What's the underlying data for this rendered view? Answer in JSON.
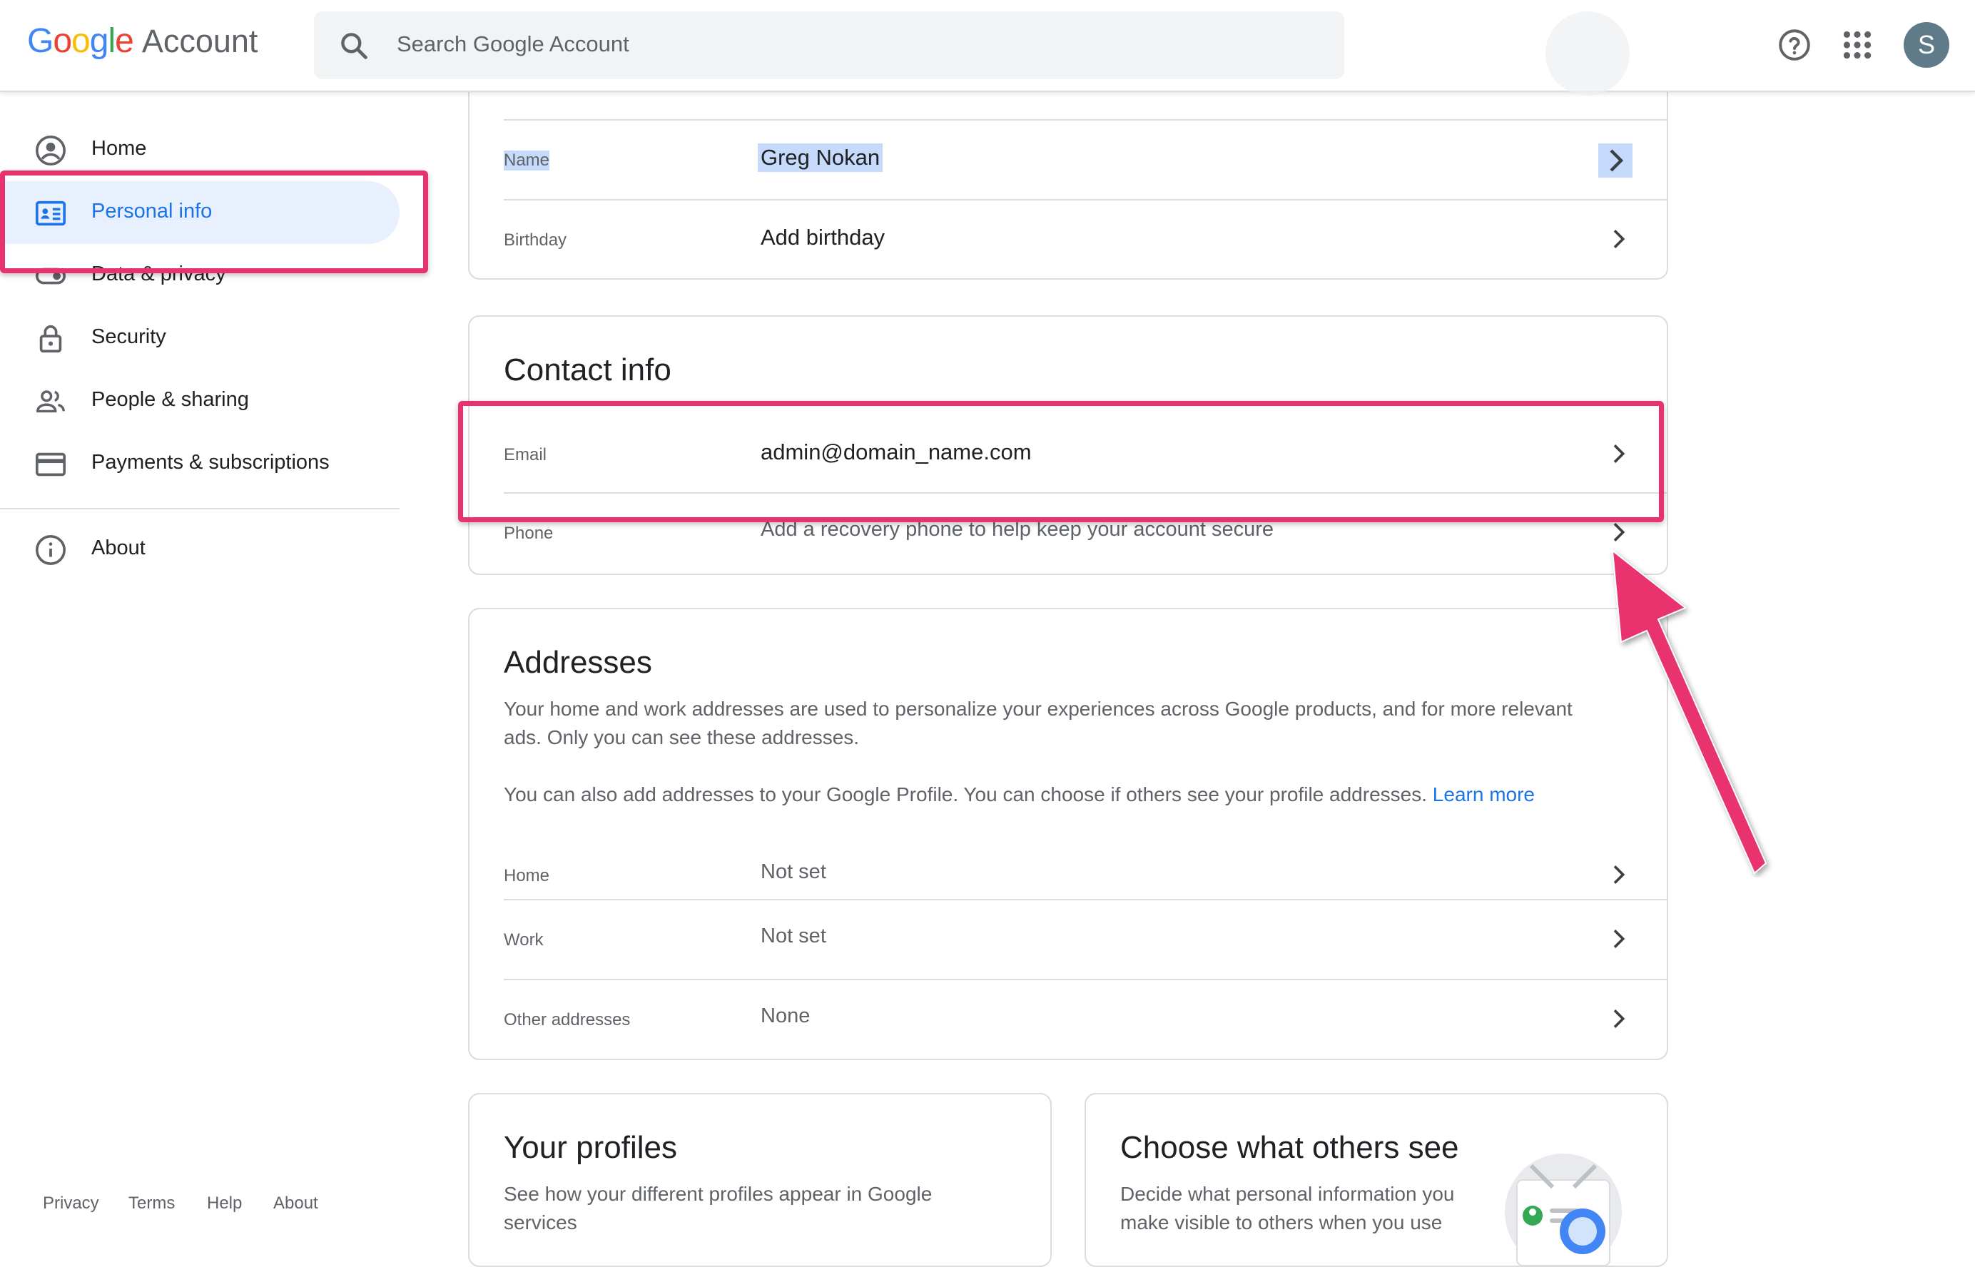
{
  "header": {
    "logo_google": [
      "G",
      "o",
      "o",
      "g",
      "l",
      "e"
    ],
    "logo_account": "Account",
    "search_placeholder": "Search Google Account",
    "avatar_letter": "S"
  },
  "sidebar": {
    "items": [
      {
        "label": "Home",
        "icon": "account-circle-icon"
      },
      {
        "label": "Personal info",
        "icon": "id-card-icon"
      },
      {
        "label": "Data & privacy",
        "icon": "toggle-icon"
      },
      {
        "label": "Security",
        "icon": "lock-icon"
      },
      {
        "label": "People & sharing",
        "icon": "people-icon"
      },
      {
        "label": "Payments & subscriptions",
        "icon": "credit-card-icon"
      },
      {
        "label": "About",
        "icon": "info-icon"
      }
    ],
    "active": "Personal info",
    "footer": [
      "Privacy",
      "Terms",
      "Help",
      "About"
    ]
  },
  "basic_info": {
    "rows": [
      {
        "label": "Name",
        "value": "Greg Nokan"
      },
      {
        "label": "Birthday",
        "value": "Add birthday"
      }
    ]
  },
  "contact_info": {
    "title": "Contact info",
    "rows": [
      {
        "label": "Email",
        "value": "admin@domain_name.com"
      },
      {
        "label": "Phone",
        "value": "Add a recovery phone to help keep your account secure"
      }
    ]
  },
  "addresses": {
    "title": "Addresses",
    "desc1_line1": "Your home and work addresses are used to personalize your experiences across Google products, and for more relevant",
    "desc1_line2": "ads. Only you can see these addresses.",
    "desc2": "You can also add addresses to your Google Profile. You can choose if others see your profile addresses.",
    "learn_more": "Learn more",
    "rows": [
      {
        "label": "Home",
        "value": "Not set"
      },
      {
        "label": "Work",
        "value": "Not set"
      },
      {
        "label": "Other addresses",
        "value": "None"
      }
    ]
  },
  "profiles": {
    "title": "Your profiles",
    "desc_line1": "See how your different profiles appear in Google",
    "desc_line2": "services"
  },
  "others_see": {
    "title": "Choose what others see",
    "desc_line1": "Decide what personal information you",
    "desc_line2": "make visible to others when you use"
  },
  "colors": {
    "accent_blue": "#1a73e8",
    "annotation_pink": "#e6336e",
    "active_nav_bg": "#e8f0fe"
  }
}
